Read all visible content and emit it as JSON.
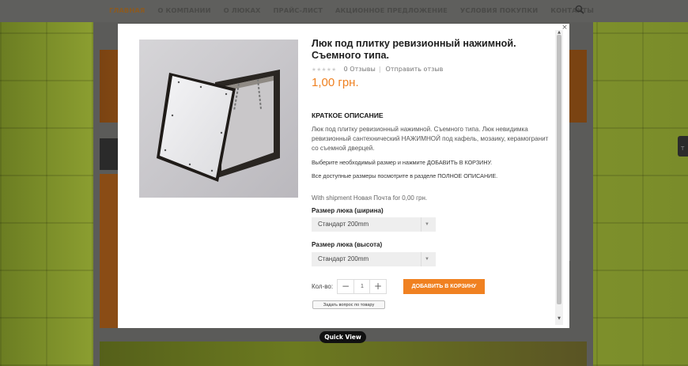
{
  "nav": {
    "items": [
      {
        "label": "ГЛАВНАЯ",
        "active": true
      },
      {
        "label": "О КОМПАНИИ",
        "active": false
      },
      {
        "label": "О ЛЮКАХ",
        "active": false
      },
      {
        "label": "ПРАЙС-ЛИСТ",
        "active": false
      },
      {
        "label": "АКЦИОННОЕ ПРЕДЛОЖЕНИЕ",
        "active": false
      },
      {
        "label": "УСЛОВИЯ ПОКУПКИ",
        "active": false
      },
      {
        "label": "КОНТАКТЫ",
        "active": false
      }
    ],
    "search_icon": "search-icon"
  },
  "product": {
    "title": "Люк под плитку ревизионный нажимной. Съемного типа.",
    "stars": "★★★★★",
    "review_count": "0 Отзывы",
    "separator": "|",
    "review_link": "Отправить отзыв",
    "price": "1,00 грн.",
    "short_desc_heading": "КРАТКОЕ ОПИСАНИЕ",
    "short_desc": "Люк под плитку ревизионный нажимной. Съемного типа. Люк невидимка ревизионный сантехнический НАЖИМНОЙ под кафель, мозаику, керамогранит со съемной дверцей.",
    "note_select": "Выберите необходимый размер и нажмите ДОБАВИТЬ В КОРЗИНУ.",
    "note_sizes": "Все доступные размеры посмотрите в разделе ПОЛНОЕ ОПИСАНИЕ.",
    "shipment": "With shipment Новая Почта for 0,00 грн."
  },
  "options": {
    "width_label": "Размер люка (ширина)",
    "width_value": "Стандарт 200mm",
    "height_label": "Размер люка (высота)",
    "height_value": "Стандарт 200mm"
  },
  "cart": {
    "qty_label": "Кол-во:",
    "qty_value": "1",
    "minus": "−",
    "plus": "+",
    "add_to_cart": "ДОБАВИТЬ В КОРЗИНУ",
    "ask_question": "Задать вопрос по товару"
  },
  "modal": {
    "close": "×",
    "quick_view": "Quick View"
  },
  "colors": {
    "accent": "#f08121",
    "price": "#ef8121"
  }
}
